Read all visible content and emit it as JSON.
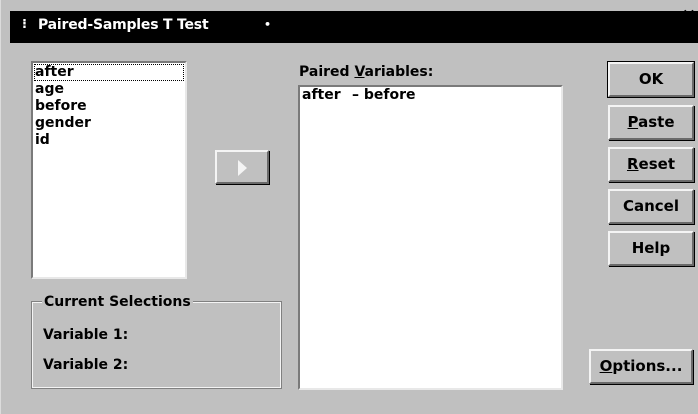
{
  "window": {
    "title": "Paired-Samples T Test",
    "close": "×"
  },
  "source_list": {
    "items": [
      "after",
      "age",
      "before",
      "gender",
      "id"
    ],
    "focused_index": 0
  },
  "paired": {
    "label_pre": "Paired ",
    "label_ul": "V",
    "label_post": "ariables:",
    "pairs": [
      {
        "first": "after",
        "second": "– before"
      }
    ]
  },
  "current_selections": {
    "legend": "Current Selections",
    "var1": "Variable 1:",
    "var2": "Variable 2:"
  },
  "buttons": {
    "ok": "OK",
    "paste_ul": "P",
    "paste_rest": "aste",
    "reset_ul": "R",
    "reset_rest": "eset",
    "cancel": "Cancel",
    "help": "Help",
    "options_ul": "O",
    "options_rest": "ptions..."
  }
}
